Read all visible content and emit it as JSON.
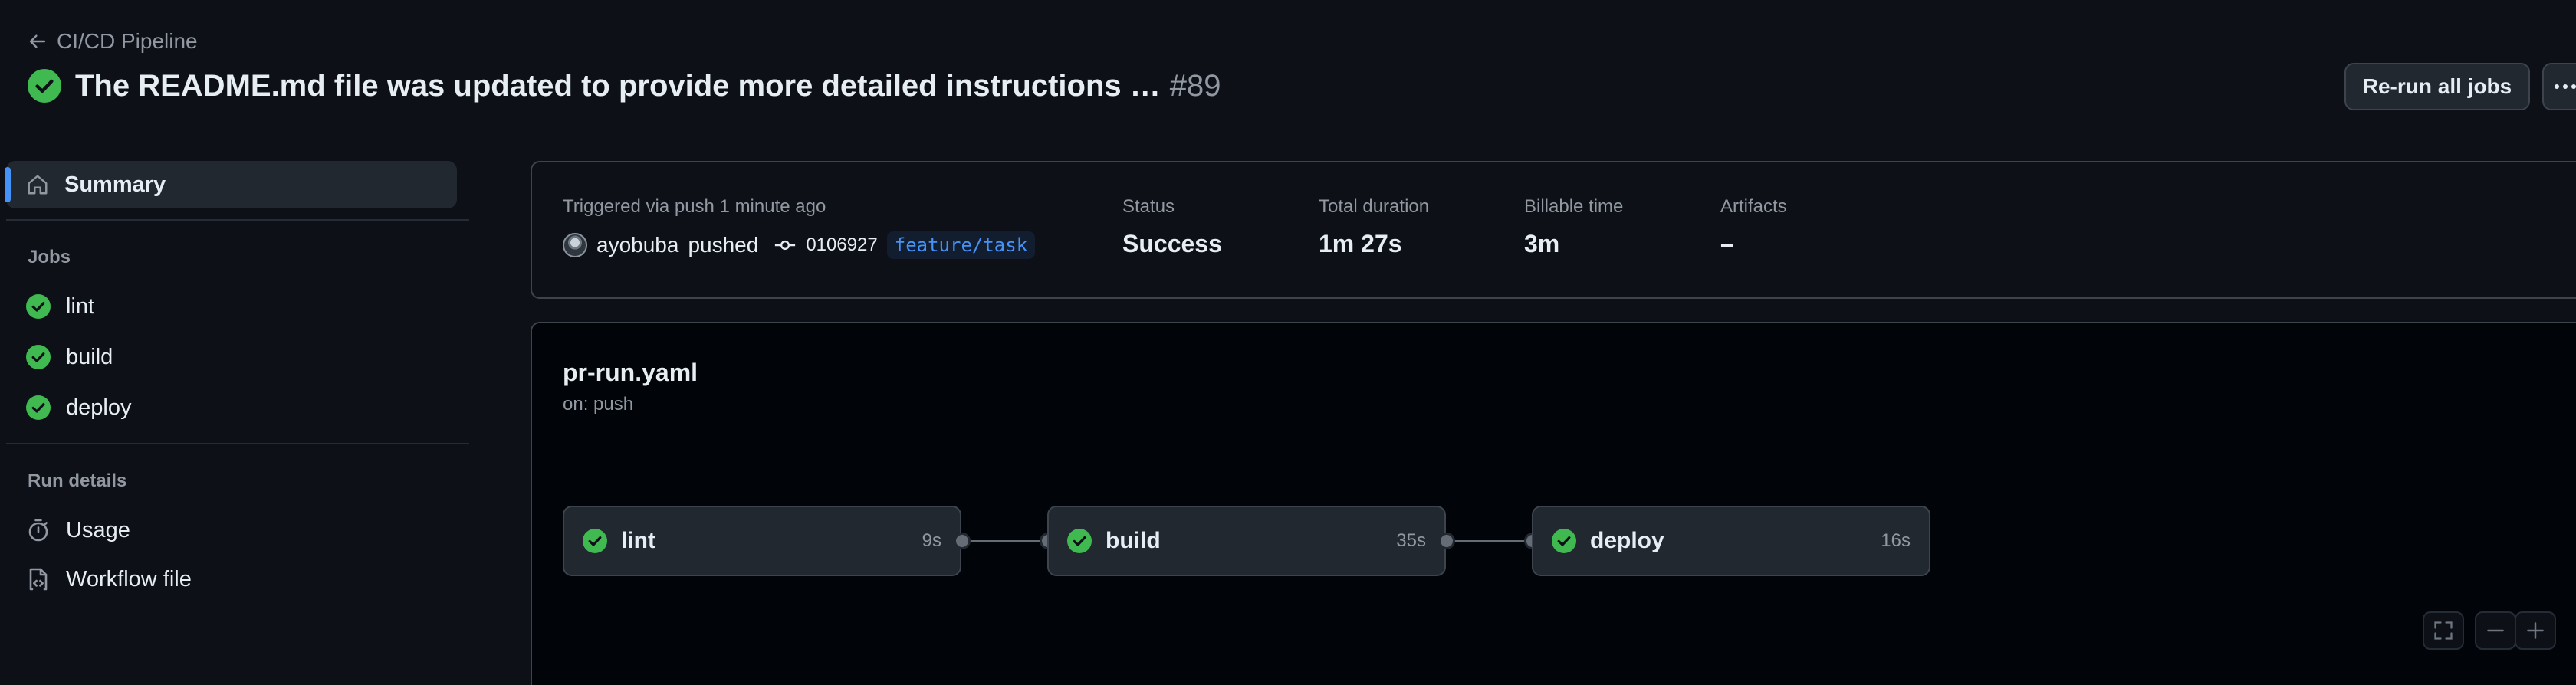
{
  "breadcrumb": {
    "back_label": "CI/CD Pipeline"
  },
  "run": {
    "title": "The README.md file was updated to provide more detailed instructions …",
    "number": "#89"
  },
  "actions": {
    "rerun_label": "Re-run all jobs"
  },
  "sidebar": {
    "summary_label": "Summary",
    "jobs_heading": "Jobs",
    "jobs": [
      {
        "label": "lint"
      },
      {
        "label": "build"
      },
      {
        "label": "deploy"
      }
    ],
    "run_details_heading": "Run details",
    "run_details": [
      {
        "label": "Usage",
        "icon": "stopwatch-icon"
      },
      {
        "label": "Workflow file",
        "icon": "file-code-icon"
      }
    ]
  },
  "summary": {
    "trigger_label": "Triggered via push 1 minute ago",
    "actor": "ayobuba",
    "actor_action": "pushed",
    "commit_sha": "0106927",
    "branch": "feature/task",
    "status_label": "Status",
    "status_value": "Success",
    "duration_label": "Total duration",
    "duration_value": "1m 27s",
    "billable_label": "Billable time",
    "billable_value": "3m",
    "artifacts_label": "Artifacts",
    "artifacts_value": "–"
  },
  "workflow": {
    "file": "pr-run.yaml",
    "trigger": "on: push",
    "jobs": [
      {
        "name": "lint",
        "duration": "9s"
      },
      {
        "name": "build",
        "duration": "35s"
      },
      {
        "name": "deploy",
        "duration": "16s"
      }
    ]
  },
  "colors": {
    "success": "#3fb950",
    "accent": "#4493f8",
    "background": "#0d1117",
    "graph_background": "#010409"
  }
}
